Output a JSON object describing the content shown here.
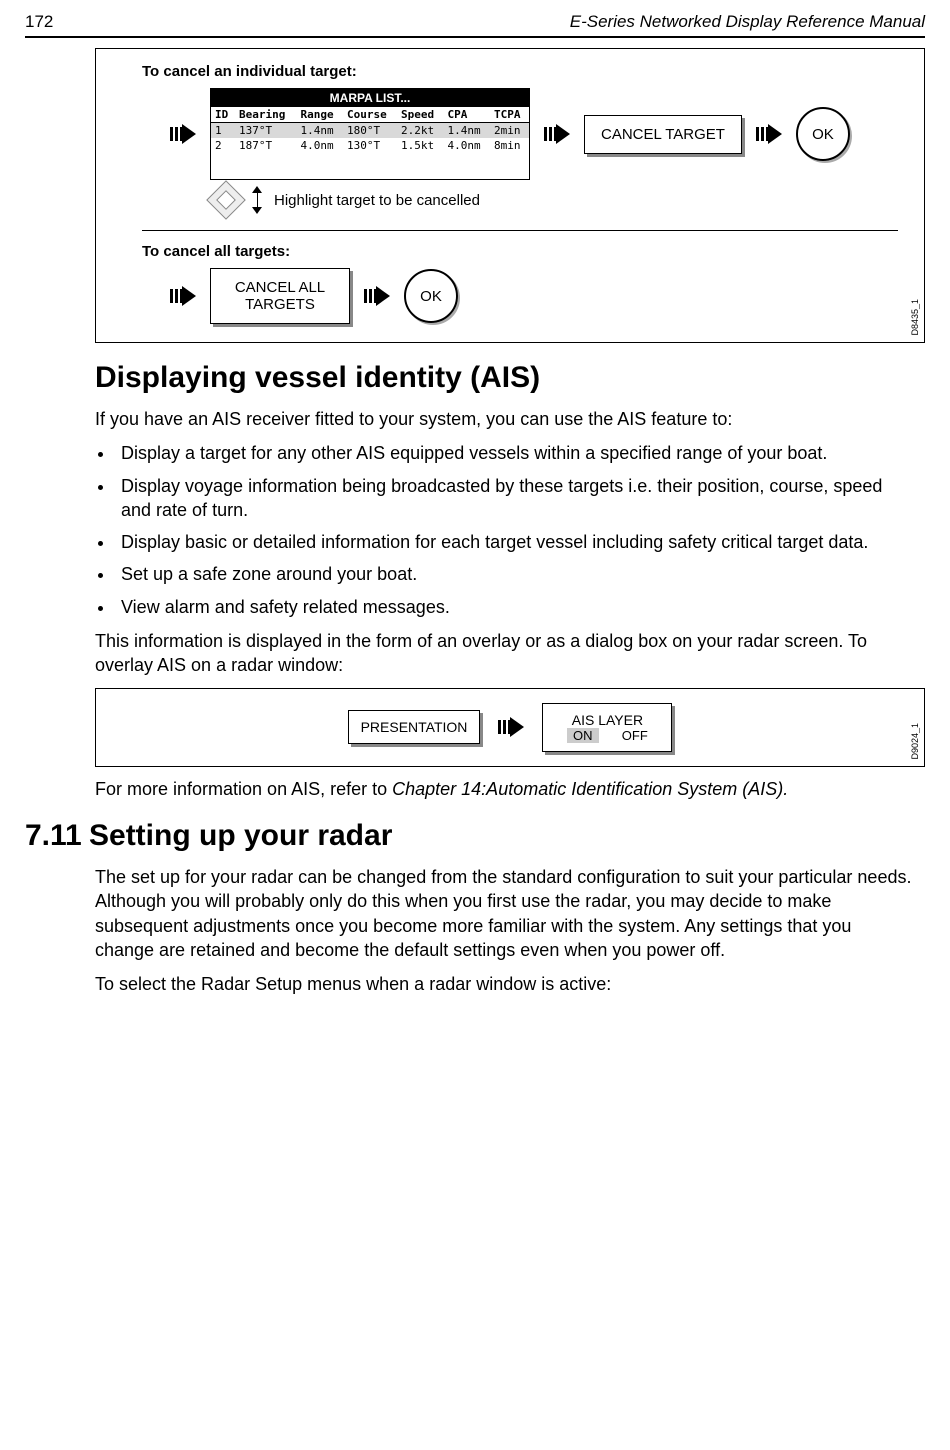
{
  "header": {
    "page_number": "172",
    "doc_title": "E-Series Networked Display Reference Manual"
  },
  "diagram1": {
    "title1": "To cancel an individual target:",
    "marpa": {
      "title": "MARPA LIST...",
      "cols": [
        "ID",
        "Bearing",
        "Range",
        "Course",
        "Speed",
        "CPA",
        "TCPA"
      ],
      "rows": [
        {
          "id": "1",
          "bearing": "137°T",
          "range": "1.4nm",
          "course": "180°T",
          "speed": "2.2kt",
          "cpa": "1.4nm",
          "tcpa": "2min"
        },
        {
          "id": "2",
          "bearing": "187°T",
          "range": "4.0nm",
          "course": "130°T",
          "speed": "1.5kt",
          "cpa": "4.0nm",
          "tcpa": "8min"
        }
      ]
    },
    "highlight_caption": "Highlight target to be cancelled",
    "btn_cancel_target": "CANCEL TARGET",
    "btn_ok": "OK",
    "title2": "To cancel all targets:",
    "btn_cancel_all_l1": "CANCEL ALL",
    "btn_cancel_all_l2": "TARGETS",
    "label": "D8435_1"
  },
  "section_ais": {
    "heading": "Displaying vessel identity (AIS)",
    "intro": "If you have an AIS receiver fitted to your system, you can use the AIS feature to:",
    "bullets": [
      "Display a target for any other AIS equipped vessels within a specified range of your boat.",
      "Display voyage information being broadcasted by these targets i.e. their position, course, speed and rate of turn.",
      "Display basic or detailed information for each target vessel including safety critical target data.",
      "Set up a safe zone around your boat.",
      "View alarm and safety related messages."
    ],
    "para2": "This information is displayed in the form of an overlay or as a dialog box on your radar screen. To overlay AIS on a radar window:"
  },
  "diagram2": {
    "btn_presentation": "PRESENTATION",
    "btn_ais_title": "AIS LAYER",
    "btn_ais_on": "ON",
    "btn_ais_off": "OFF",
    "label": "D9024_1"
  },
  "ais_footer": {
    "text_a": "For more information on AIS, refer to ",
    "text_b": "Chapter 14:Automatic Identification System (AIS)."
  },
  "section_radar": {
    "number": "7.11",
    "heading": "Setting up your radar",
    "para1": "The set up for your radar can be changed from the standard configuration to suit your particular needs. Although you will probably only do this when you first use the radar, you may decide to make subsequent adjustments once you become more familiar with the system. Any settings that you change are retained and become the default settings even when you power off.",
    "para2": "To select the Radar Setup menus when a radar window is active:"
  }
}
